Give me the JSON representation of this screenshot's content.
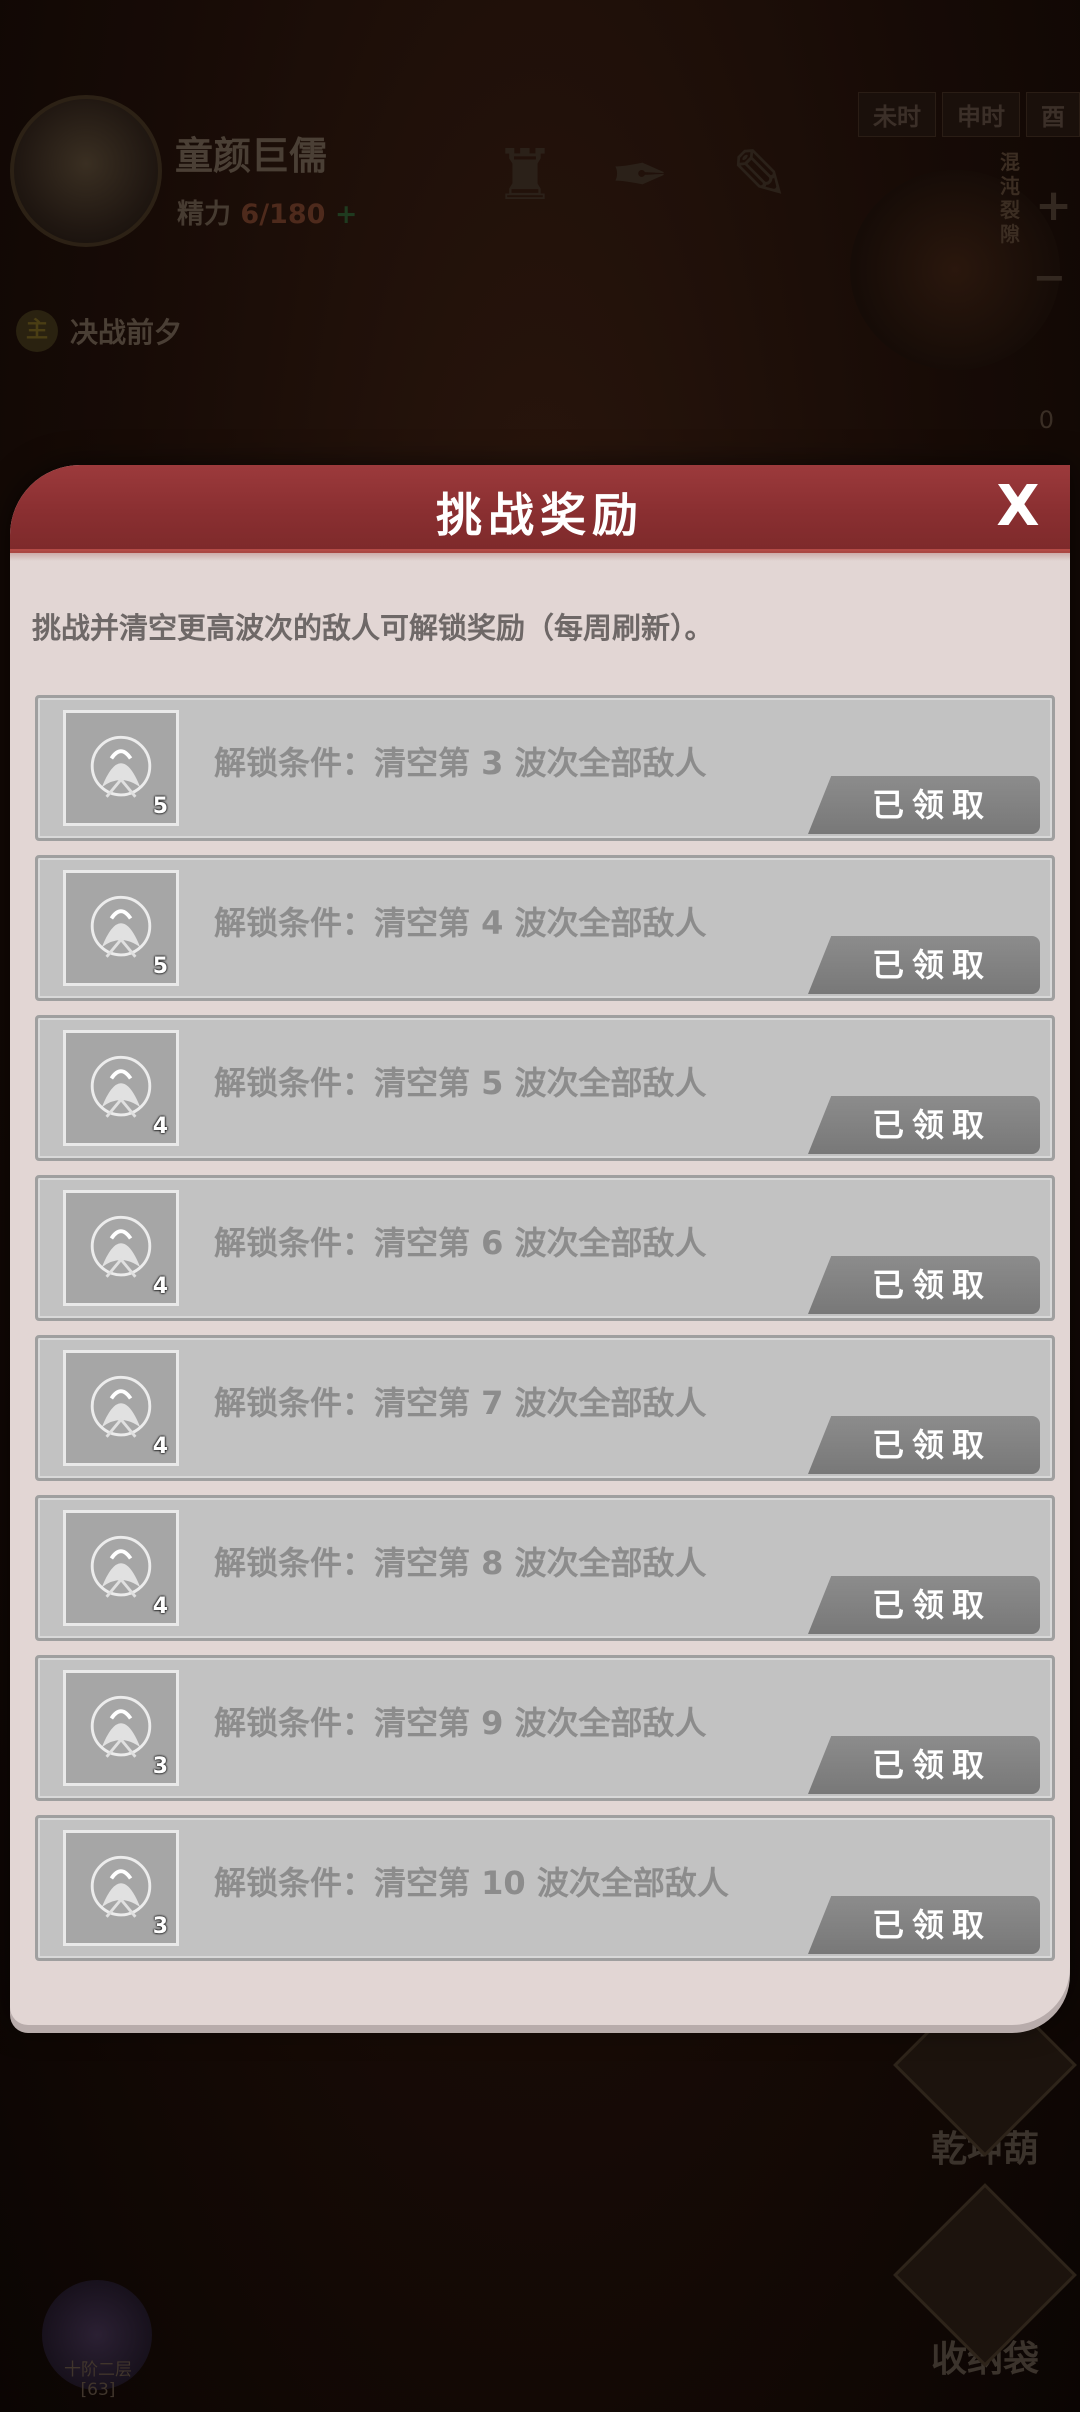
{
  "background": {
    "player_name": "童颜巨儒",
    "stamina_label": "精力",
    "stamina_value": "6/180",
    "stamina_plus": "+",
    "time_tabs": [
      "未时",
      "申时",
      "酉"
    ],
    "side_vertical_text": "混沌裂隙",
    "quest_tag": "主",
    "quest_title": "决战前夕",
    "counter": "0",
    "qiankun_label": "乾坤葫",
    "storage_label": "收纳袋",
    "realm_label": "十阶二层",
    "realm_level": "[63]"
  },
  "modal": {
    "title": "挑战奖励",
    "close_label": "X",
    "description": "挑战并清空更高波次的敌人可解锁奖励（每周刷新）。",
    "rewards": [
      {
        "condition": "解锁条件：清空第 3 波次全部敌人",
        "count": "5",
        "status": "已领取"
      },
      {
        "condition": "解锁条件：清空第 4 波次全部敌人",
        "count": "5",
        "status": "已领取"
      },
      {
        "condition": "解锁条件：清空第 5 波次全部敌人",
        "count": "4",
        "status": "已领取"
      },
      {
        "condition": "解锁条件：清空第 6 波次全部敌人",
        "count": "4",
        "status": "已领取"
      },
      {
        "condition": "解锁条件：清空第 7 波次全部敌人",
        "count": "4",
        "status": "已领取"
      },
      {
        "condition": "解锁条件：清空第 8 波次全部敌人",
        "count": "4",
        "status": "已领取"
      },
      {
        "condition": "解锁条件：清空第 9 波次全部敌人",
        "count": "3",
        "status": "已领取"
      },
      {
        "condition": "解锁条件：清空第 10 波次全部敌人",
        "count": "3",
        "status": "已领取"
      }
    ]
  },
  "colors": {
    "header_red": "#8a2f31",
    "panel_bg": "#e2d6d4",
    "row_bg": "#c2c2c2",
    "claimed_button": "#808080"
  }
}
